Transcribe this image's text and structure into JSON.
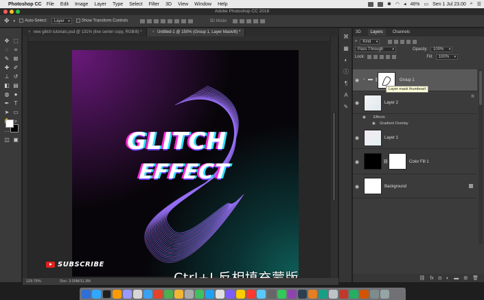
{
  "menubar": {
    "app": "Photoshop CC",
    "items": [
      "File",
      "Edit",
      "Image",
      "Layer",
      "Type",
      "Select",
      "Filter",
      "3D",
      "View",
      "Window",
      "Help"
    ],
    "battery": "46%",
    "datetime": "Sen 1 Jul  23.00"
  },
  "window": {
    "title": "Adobe Photoshop CC 2018"
  },
  "options": {
    "auto_select_label": "Auto-Select:",
    "auto_select_value": "Layer",
    "transform_label": "Show Transform Controls",
    "mode_3d": "3D Mode:"
  },
  "tabs": [
    {
      "label": "new glitch tutorials.psd @ 131% (line center copy, RGB/8) *"
    },
    {
      "label": "Untitled-1 @ 150% (Group 1, Layer Mask/8) *"
    }
  ],
  "canvas": {
    "line1": "GLITCH",
    "line2": "EFFECT"
  },
  "overlay": {
    "subscribe": "SUBSCRIBE",
    "subtitle": "Ctrl+I 反相填充蒙版"
  },
  "status": {
    "zoom": "129.75%",
    "doc": "Doc: 3.00M/11.3M"
  },
  "panel": {
    "tabs": [
      "3D",
      "Layers",
      "Channels"
    ],
    "kind": "Kind",
    "blend": "Pass Through",
    "opacity_label": "Opacity:",
    "opacity_value": "100%",
    "lock_label": "Lock:",
    "fill_label": "Fill:",
    "fill_value": "100%",
    "tooltip": "Layer mask thumbnail",
    "layers": [
      {
        "name": "Group 1"
      },
      {
        "name": "Layer 2",
        "fx": "fx"
      },
      {
        "name": "Layer 1"
      },
      {
        "name": "Color Fill 1"
      },
      {
        "name": "Background"
      }
    ],
    "effects_label": "Effects",
    "effect_item": "Gradient Overlay"
  },
  "colors": {
    "accent_magenta": "#ff2ad4",
    "accent_cyan": "#2de0ff",
    "selected_layer": "#595959"
  }
}
